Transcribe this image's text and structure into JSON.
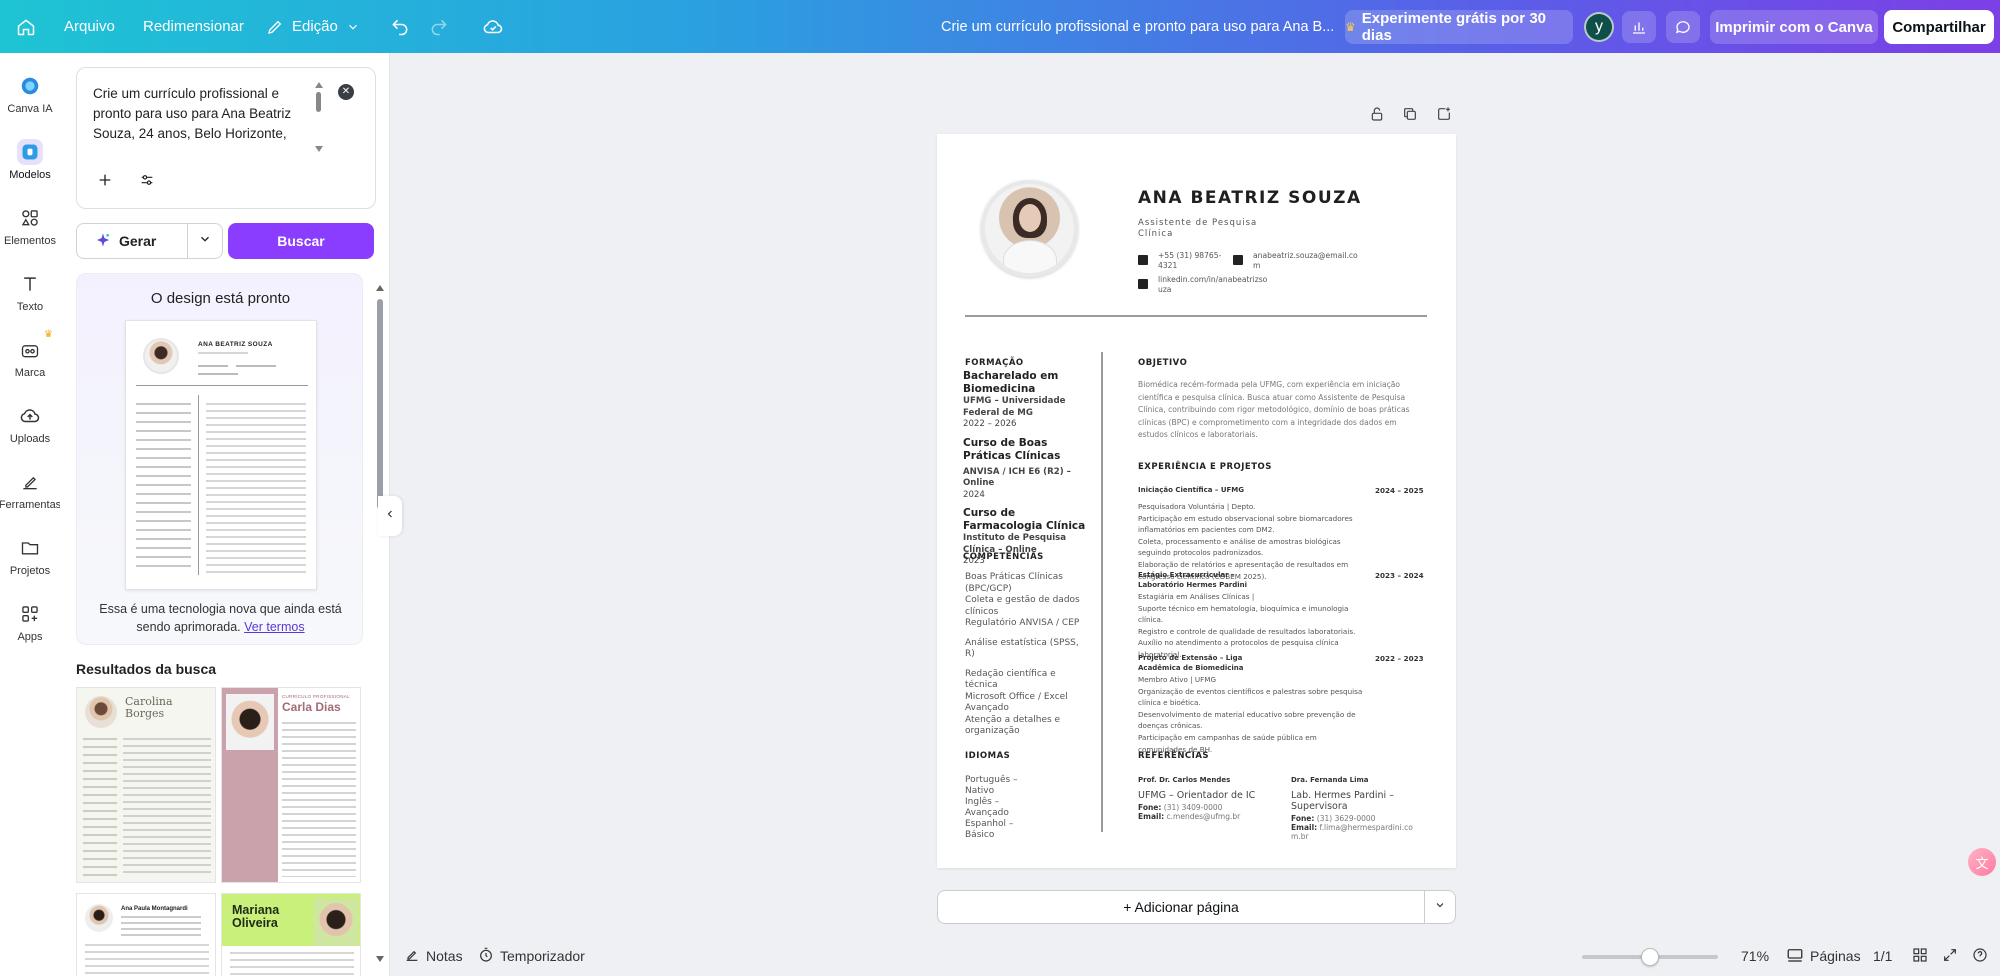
{
  "topbar": {
    "menu": {
      "file": "Arquivo",
      "resize": "Redimensionar",
      "edit": "Edição"
    },
    "doc_title": "Crie um currículo profissional e pronto para uso para Ana B...",
    "trial": "Experimente grátis por 30 dias",
    "avatar_letter": "y",
    "print": "Imprimir com o Canva",
    "share": "Compartilhar"
  },
  "rail": {
    "items": [
      {
        "label": "Canva IA"
      },
      {
        "label": "Modelos"
      },
      {
        "label": "Elementos"
      },
      {
        "label": "Texto"
      },
      {
        "label": "Marca"
      },
      {
        "label": "Uploads"
      },
      {
        "label": "Ferramentas"
      },
      {
        "label": "Projetos"
      },
      {
        "label": "Apps"
      }
    ]
  },
  "panel": {
    "prompt": "Crie um currículo profissional e pronto para uso para Ana Beatriz Souza, 24 anos, Belo Horizonte,",
    "generate": "Gerar",
    "search": "Buscar",
    "ready_title": "O design está pronto",
    "ready_note": "Essa é uma tecnologia nova que ainda está sendo aprimorada.",
    "terms_link": "Ver termos",
    "results_title": "Resultados da busca",
    "results": [
      {
        "name_line1": "Carolina",
        "name_line2": "Borges"
      },
      {
        "tag": "CURRÍCULO PROFISSIONAL",
        "name": "Carla Dias"
      },
      {
        "name": "Ana Paula Montagnardi"
      },
      {
        "name_line1": "Mariana",
        "name_line2": "Oliveira"
      }
    ]
  },
  "resume": {
    "name": "ANA BEATRIZ SOUZA",
    "role_line1": "Assistente de Pesquisa",
    "role_line2": "Clínica",
    "phone": "+55 (31) 98765-4321",
    "email": "anabeatriz.souza@email.com",
    "linkedin": "linkedin.com/in/anabeatrizsouza",
    "education_heading": "FORMAÇÃO",
    "education": [
      {
        "title": "Bacharelado em Biomedicina",
        "org": "UFMG – Universidade Federal de MG",
        "years": "2022 – 2026"
      },
      {
        "title": "Curso de Boas Práticas Clínicas",
        "org": "ANVISA / ICH E6 (R2) – Online",
        "years": "2024"
      },
      {
        "title": "Curso de Farmacologia Clínica",
        "org": "Instituto de Pesquisa Clínica – Online",
        "years": "2023"
      }
    ],
    "skills_heading": "COMPETÊNCIAS",
    "skills": [
      "Boas Práticas Clínicas (BPC/GCP)",
      "Coleta e gestão de dados clínicos",
      "Regulatório ANVISA / CEP",
      "Análise estatística (SPSS, R)",
      "Redação científica e técnica",
      "Microsoft Office / Excel Avançado",
      "Atenção a detalhes e organização"
    ],
    "languages_heading": "IDIOMAS",
    "languages": [
      "Português – Nativo",
      "Inglês – Avançado",
      "Espanhol – Básico"
    ],
    "objective_heading": "OBJETIVO",
    "objective": "Biomédica recém-formada pela UFMG, com experiência em iniciação científica e pesquisa clínica. Busca atuar como Assistente de Pesquisa Clínica, contribuindo com rigor metodológico, domínio de boas práticas clínicas (BPC) e comprometimento com a integridade dos dados em estudos clínicos e laboratoriais.",
    "experience_heading": "EXPERIÊNCIA E PROJETOS",
    "experience": [
      {
        "title": "Iniciação Científica – UFMG",
        "years": "2024 – 2025",
        "lines": [
          "Pesquisadora Voluntária | Depto.",
          "Participação em estudo observacional sobre biomarcadores inflamatórios em pacientes com DM2.",
          "Coleta, processamento e análise de amostras biológicas seguindo protocolos padronizados.",
          "Elaboração de relatórios e apresentação de resultados em congresso científico (COBEM 2025)."
        ]
      },
      {
        "title": "Estágio Extracurricular – Laboratório Hermes Pardini",
        "years": "2023 – 2024",
        "lines": [
          "Estagiária em Análises Clínicas |",
          "Suporte técnico em hematologia, bioquímica e imunologia clínica.",
          "Registro e controle de qualidade de resultados laboratoriais.",
          "Auxílio no atendimento a protocolos de pesquisa clínica laboratorial."
        ]
      },
      {
        "title": "Projeto de Extensão – Liga Acadêmica de Biomedicina",
        "years": "2022 – 2023",
        "lines": [
          "Membro Ativo | UFMG",
          "Organização de eventos científicos e palestras sobre pesquisa clínica e bioética.",
          "Desenvolvimento de material educativo sobre prevenção de doenças crônicas.",
          "Participação em campanhas de saúde pública em comunidades de BH."
        ]
      }
    ],
    "references_heading": "REFERÊNCIAS",
    "references": [
      {
        "name": "Prof. Dr. Carlos Mendes",
        "org": "UFMG – Orientador de IC",
        "phone_label": "Fone:",
        "phone": "(31) 3409-0000",
        "email_label": "Email:",
        "email": "c.mendes@ufmg.br"
      },
      {
        "name": "Dra. Fernanda Lima",
        "org": "Lab. Hermes Pardini – Supervisora",
        "phone_label": "Fone:",
        "phone": "(31) 3629-0000",
        "email_label": "Email:",
        "email": "f.lima@hermespardini.com.br"
      }
    ]
  },
  "canvas": {
    "add_page": "+ Adicionar página"
  },
  "bottombar": {
    "notes": "Notas",
    "timer": "Temporizador",
    "zoom": "71%",
    "zoom_fraction": 0.5,
    "pages": "Páginas",
    "page_count": "1/1"
  }
}
